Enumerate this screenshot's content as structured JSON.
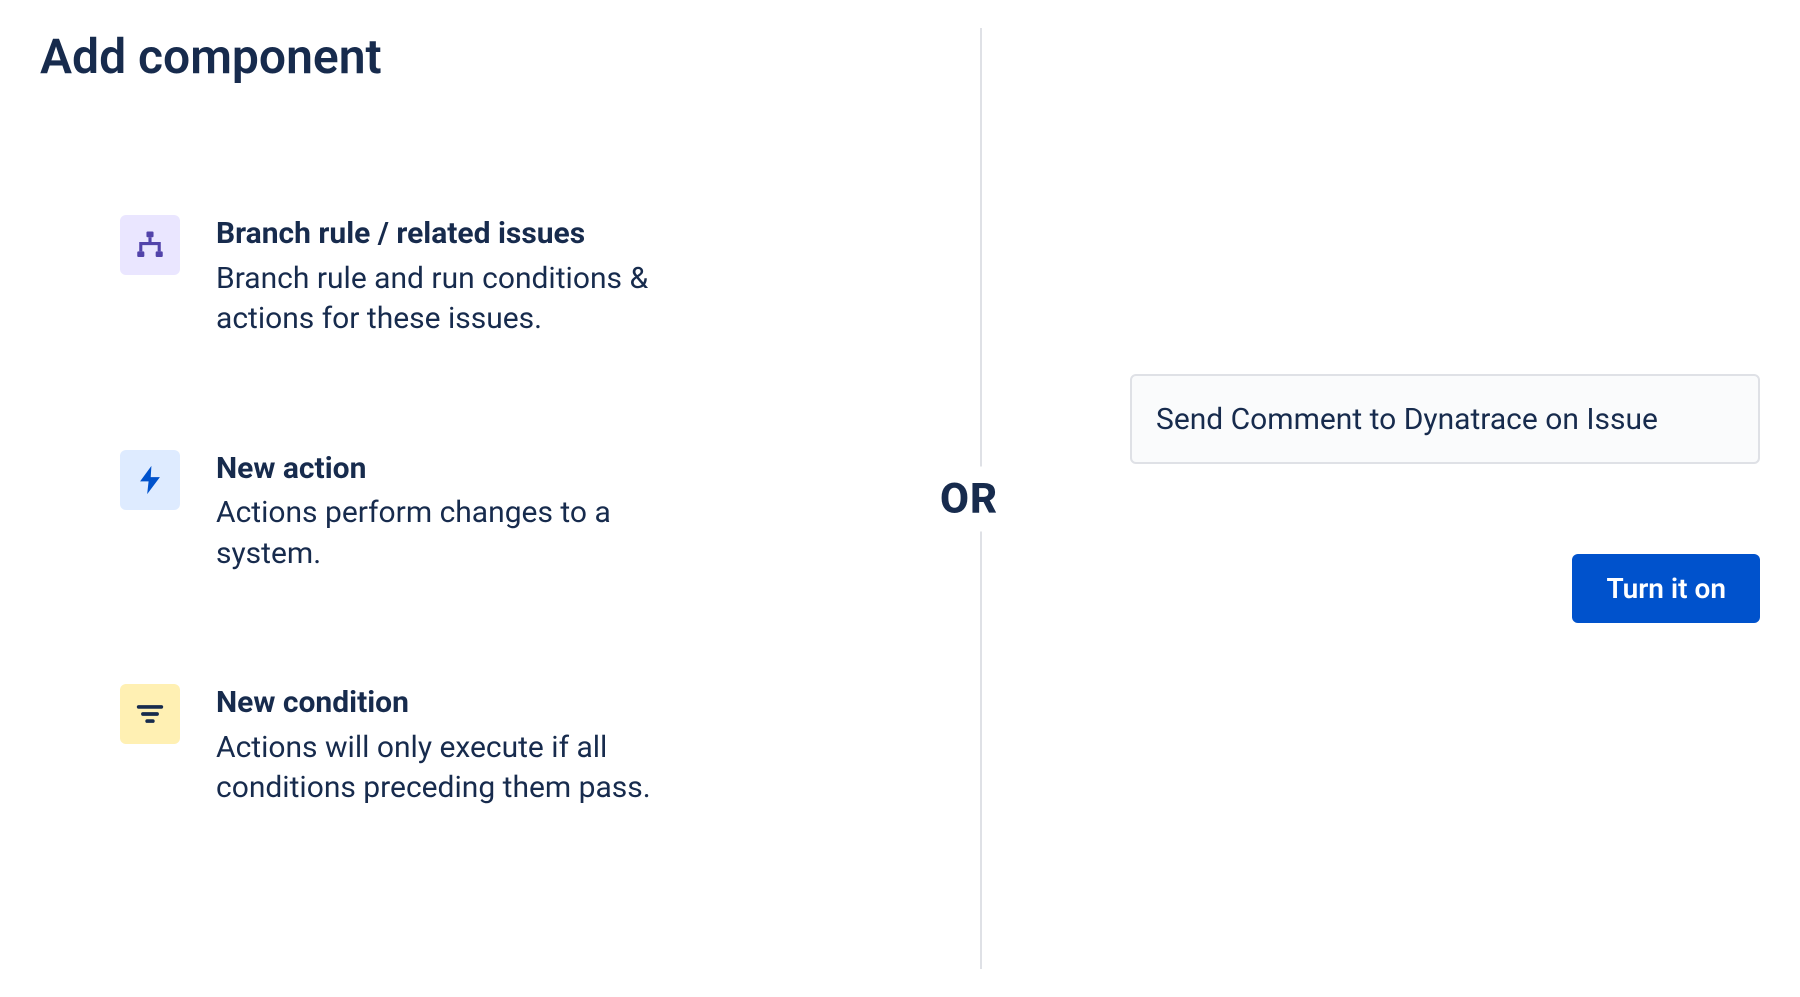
{
  "page_title": "Add component",
  "separator_label": "OR",
  "options": [
    {
      "title": "Branch rule / related issues",
      "description": "Branch rule and run conditions & actions for these issues.",
      "icon": "branch"
    },
    {
      "title": "New action",
      "description": "Actions perform changes to a system.",
      "icon": "bolt"
    },
    {
      "title": "New condition",
      "description": "Actions will only execute if all conditions preceding them pass.",
      "icon": "filter"
    }
  ],
  "rule_name_input": {
    "value": "Send Comment to Dynatrace on Issue"
  },
  "turn_on_button_label": "Turn it on"
}
